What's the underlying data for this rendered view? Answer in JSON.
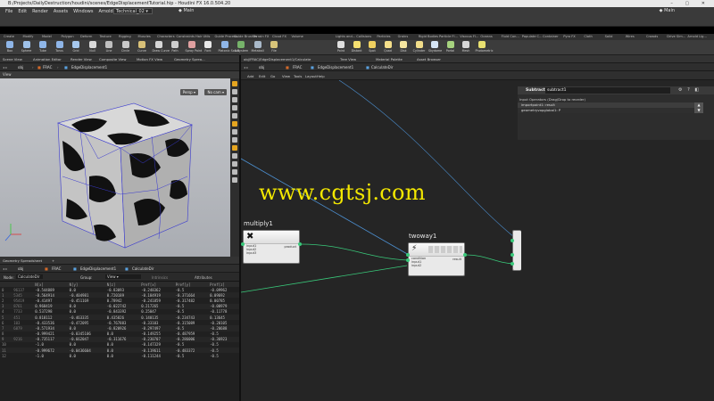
{
  "window": {
    "title": "B:/Projects/DailyDestruction/houdini/scenes/EdgeDisplacementTutorial.hip - Houdini FX 16.0.504.20",
    "controls": "–  ▢  ✕"
  },
  "menubar": {
    "items": [
      "File",
      "Edit",
      "Render",
      "Assets",
      "Windows",
      "Arnold",
      "Help"
    ],
    "desktop": "Technical_02",
    "main_label": "Main",
    "right_main": "Main"
  },
  "shelf": {
    "left_tabs": [
      "Create",
      "Modify",
      "Model",
      "Polygon",
      "Deform",
      "Texture",
      "Rigging",
      "Muscles",
      "Characters",
      "Constraints",
      "Hair Utils",
      "Guide Process",
      "Guide Brushes",
      "Terrain FX",
      "Cloud FX",
      "Volume"
    ],
    "right_tabs": [
      "Lights and...",
      "Collisions",
      "Particles",
      "Grains",
      "Rigid Bodies",
      "Particle Fl...",
      "Viscous Fl...",
      "Oceans",
      "Fluid Con...",
      "Populate C...",
      "Container",
      "Pyro FX",
      "Cloth",
      "Solid",
      "Wires",
      "Crowds",
      "Drive Sim...",
      "Arnold Lig..."
    ],
    "left_tools": [
      {
        "label": "Box",
        "color": "#8fb6e8"
      },
      {
        "label": "Sphere",
        "color": "#9fc2ea"
      },
      {
        "label": "Tube",
        "color": "#8fb6e8"
      },
      {
        "label": "Torus",
        "color": "#8fb6e8"
      },
      {
        "label": "Grid",
        "color": "#a6c8ee"
      },
      {
        "label": "Null",
        "color": "#d9d9d9"
      },
      {
        "label": "Line",
        "color": "#bfbfbf"
      },
      {
        "label": "Circle",
        "color": "#c9c9c9"
      },
      {
        "label": "Curve",
        "color": "#d9c178"
      },
      {
        "label": "Draw Curve",
        "color": "#d7d7d7"
      },
      {
        "label": "Path",
        "color": "#cfcfcf"
      },
      {
        "label": "Spray Paint",
        "color": "#e0a0a0"
      },
      {
        "label": "Font",
        "color": "#e8e8e8"
      },
      {
        "label": "Platonic Solids",
        "color": "#8fb6e8"
      },
      {
        "label": "L-System",
        "color": "#76b36a"
      },
      {
        "label": "Metaball",
        "color": "#a9b9c9"
      },
      {
        "label": "File",
        "color": "#d8c47a"
      }
    ],
    "right_tools": [
      {
        "label": "Point",
        "color": "#e0e0e0"
      },
      {
        "label": "Distant",
        "color": "#f5e070"
      },
      {
        "label": "Spot",
        "color": "#f0d060"
      },
      {
        "label": "Quad",
        "color": "#f5df8a"
      },
      {
        "label": "Disk",
        "color": "#f5e6a0"
      },
      {
        "label": "Cylinder",
        "color": "#f1dd8a"
      },
      {
        "label": "Skydome",
        "color": "#d5e5f5"
      },
      {
        "label": "Portal",
        "color": "#a7d37f"
      },
      {
        "label": "Mesh",
        "color": "#d8d8d8"
      },
      {
        "label": "Photometric",
        "color": "#e8e070"
      }
    ]
  },
  "left_pane": {
    "tabs": [
      "Scene View",
      "Animation Editor",
      "Render View",
      "Composite View",
      "Motion FX View",
      "Geometry Sprea..."
    ],
    "path": {
      "obj": "obj",
      "frac": "FRAC",
      "node": "EdgeDisplacement1"
    },
    "viewport": {
      "view_label": "View",
      "camera_menu": "Persp",
      "cam_menu": "No cam"
    }
  },
  "spreadsheet": {
    "tabs": [
      "Geometry Spreadsheet"
    ],
    "path": {
      "obj": "obj",
      "frac": "FRAC",
      "node": "EdgeDisplacement1",
      "leaf": "CalculateDir"
    },
    "toolbar": {
      "node_label": "Node:",
      "node_value": "CalculateDir",
      "group_label": "Group:",
      "view_label": "View",
      "intrinsics": "Intrinsics",
      "attributes": "Attributes"
    },
    "columns": [
      "",
      "",
      "N[x]",
      "N[y]",
      "N[z]",
      "Pref[x]",
      "Pref[y]",
      "Pref[z]"
    ],
    "rows": [
      [
        "0",
        "96137",
        "-0.544889",
        "0.0",
        "-0.83093",
        "-0.248362",
        "-0.5",
        "-0.09962"
      ],
      [
        "1",
        "5345",
        "-0.564914",
        "-0.404981",
        "0.720189",
        "-0.184919",
        "-0.371664",
        "0.09692"
      ],
      [
        "2",
        "95419",
        "-0.41497",
        "-0.451169",
        "0.78942",
        "-0.241859",
        "-0.317482",
        "0.00785"
      ],
      [
        "3",
        "8761",
        "0.968419",
        "0.0",
        "-0.022742",
        "0.217265",
        "-0.5",
        "-0.00979"
      ],
      [
        "4",
        "7733",
        "0.537298",
        "0.0",
        "-0.843392",
        "0.25047",
        "-0.5",
        "-0.11778"
      ],
      [
        "5",
        "451",
        "0.818112",
        "-0.463335",
        "0.435826",
        "0.140135",
        "-0.234743",
        "0.13645"
      ],
      [
        "6",
        "103",
        "-0.433536",
        "-0.472095",
        "-0.767883",
        "-0.33103",
        "-0.315089",
        "-0.20105"
      ],
      [
        "7",
        "6879",
        "-0.571934",
        "0.0",
        "-0.820926",
        "-0.297497",
        "-0.5",
        "-0.20688"
      ],
      [
        "8",
        "",
        "-0.999421",
        "-0.0345106",
        "0.0",
        "-0.149255",
        "-0.487959",
        "-0.5"
      ],
      [
        "9",
        "9216",
        "-0.735117",
        "-0.662047",
        "-0.311676",
        "-0.230707",
        "-0.286006",
        "-0.36923"
      ],
      [
        "10",
        "",
        "-1.0",
        "0.0",
        "0.0",
        "-0.147329",
        "-0.5",
        "-0.5"
      ],
      [
        "11",
        "",
        "-0.999672",
        "-0.0436604",
        "0.0",
        "-0.119611",
        "-0.483372",
        "-0.5"
      ],
      [
        "12",
        "",
        "-1.0",
        "0.0",
        "0.0",
        "-0.111244",
        "-0.5",
        "-0.5"
      ]
    ]
  },
  "network_pane": {
    "tabs": [
      "obj/FRAC/EdgeDisplacement1/Calculate",
      "Tree View",
      "Material Palette",
      "Asset Browser"
    ],
    "path": {
      "obj": "obj",
      "frac": "FRAC",
      "node": "EdgeDisplacement1",
      "leaf": "CalculateDir"
    },
    "menu": [
      "Add",
      "Edit",
      "Go",
      "View",
      "Tools",
      "Layout",
      "Help"
    ],
    "nodes": {
      "multiply": {
        "name": "multiply1",
        "inputs": [
          "input1",
          "input2",
          "input3"
        ],
        "output": "product"
      },
      "twoway": {
        "name": "twoway1",
        "inputs": [
          "condition",
          "input1",
          "input2"
        ],
        "output": "result"
      }
    }
  },
  "parameters": {
    "node_type": "Subtract",
    "node_name": "subtract1",
    "section": "Input Operators (Drag/Drop to reorder)",
    "rows": [
      "importpoint1: result",
      "geometryvopglobal1: P"
    ]
  },
  "watermark": "www.cgtsj.com",
  "colors": {
    "wire_green": "#39c97a",
    "wire_blue": "#4c8fd0",
    "accent_yellow": "#f4e800",
    "viewport_bg": "#b8bbc0"
  }
}
